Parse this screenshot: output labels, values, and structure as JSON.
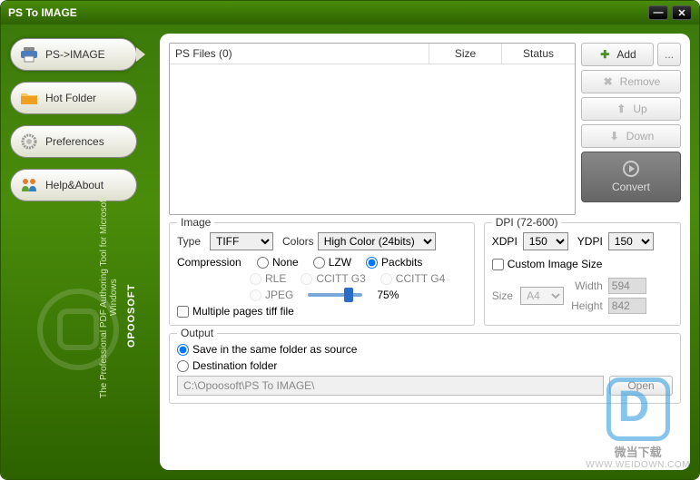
{
  "app_title": "PS To IMAGE",
  "win_min": "—",
  "win_close": "✕",
  "sidebar": {
    "items": [
      {
        "label": "PS->IMAGE",
        "icon": "printer"
      },
      {
        "label": "Hot Folder",
        "icon": "folder"
      },
      {
        "label": "Preferences",
        "icon": "gear"
      },
      {
        "label": "Help&About",
        "icon": "people"
      }
    ],
    "brand": "OPOOSOFT",
    "tagline": "The Professional PDF Authoring Tool for Microsoft Windows"
  },
  "file_list": {
    "header_name": "PS Files (0)",
    "header_size": "Size",
    "header_status": "Status"
  },
  "actions": {
    "add": "Add",
    "add_more": "...",
    "remove": "Remove",
    "up": "Up",
    "down": "Down",
    "convert": "Convert"
  },
  "image": {
    "group": "Image",
    "type_label": "Type",
    "type_value": "TIFF",
    "colors_label": "Colors",
    "colors_value": "High Color (24bits)",
    "compression_label": "Compression",
    "comp_none": "None",
    "comp_lzw": "LZW",
    "comp_packbits": "Packbits",
    "comp_rle": "RLE",
    "comp_g3": "CCITT G3",
    "comp_g4": "CCITT G4",
    "comp_jpeg": "JPEG",
    "jpeg_quality": "75%",
    "multi_tiff": "Multiple pages tiff file"
  },
  "dpi": {
    "group": "DPI (72-600)",
    "xdpi_label": "XDPI",
    "xdpi_value": "150",
    "ydpi_label": "YDPI",
    "ydpi_value": "150",
    "custom_label": "Custom Image Size",
    "size_label": "Size",
    "size_value": "A4",
    "width_label": "Width",
    "width_value": "594",
    "height_label": "Height",
    "height_value": "842"
  },
  "output": {
    "group": "Output",
    "same_folder": "Save in the same folder as source",
    "dest_folder": "Destination folder",
    "path": "C:\\Opoosoft\\PS To IMAGE\\",
    "open": "Open"
  },
  "watermark": {
    "text": "微当下载",
    "url": "WWW.WEIDOWN.COM"
  }
}
